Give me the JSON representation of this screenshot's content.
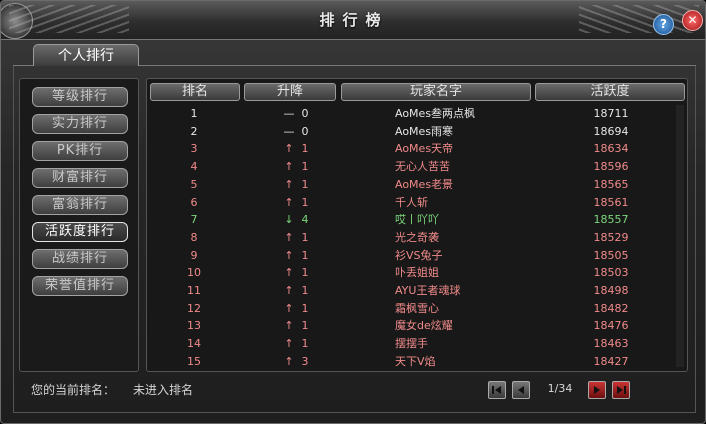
{
  "window": {
    "title": "排行榜",
    "help_label": "?",
    "close_label": "✕"
  },
  "tabs": [
    {
      "label": "个人排行"
    }
  ],
  "categories": [
    {
      "label": "等级排行",
      "active": false
    },
    {
      "label": "实力排行",
      "active": false
    },
    {
      "label": "PK排行",
      "active": false
    },
    {
      "label": "财富排行",
      "active": false
    },
    {
      "label": "富翁排行",
      "active": false
    },
    {
      "label": "活跃度排行",
      "active": true
    },
    {
      "label": "战绩排行",
      "active": false
    },
    {
      "label": "荣誉值排行",
      "active": false
    }
  ],
  "table": {
    "headers": [
      "排名",
      "升降",
      "玩家名字",
      "活跃度"
    ],
    "colors": {
      "white": "#e6e6e6",
      "red": "#f08a8a",
      "green": "#7cd87c"
    },
    "rows": [
      {
        "rank": "1",
        "arrow": "—",
        "change": "0",
        "name": "AoMes叁两点枫",
        "activity": "18711",
        "color": "white"
      },
      {
        "rank": "2",
        "arrow": "—",
        "change": "0",
        "name": "AoMes雨寒",
        "activity": "18694",
        "color": "white"
      },
      {
        "rank": "3",
        "arrow": "↑",
        "change": "1",
        "name": "AoMes天帝",
        "activity": "18634",
        "color": "red"
      },
      {
        "rank": "4",
        "arrow": "↑",
        "change": "1",
        "name": "无心人苦苦",
        "activity": "18596",
        "color": "red"
      },
      {
        "rank": "5",
        "arrow": "↑",
        "change": "1",
        "name": "AoMes老景",
        "activity": "18565",
        "color": "red"
      },
      {
        "rank": "6",
        "arrow": "↑",
        "change": "1",
        "name": "千人斩",
        "activity": "18561",
        "color": "red"
      },
      {
        "rank": "7",
        "arrow": "↓",
        "change": "4",
        "name": "哎丨吖吖",
        "activity": "18557",
        "color": "green"
      },
      {
        "rank": "8",
        "arrow": "↑",
        "change": "1",
        "name": "光之奇袭",
        "activity": "18529",
        "color": "red"
      },
      {
        "rank": "9",
        "arrow": "↑",
        "change": "1",
        "name": "衫VS兔子",
        "activity": "18505",
        "color": "red"
      },
      {
        "rank": "10",
        "arrow": "↑",
        "change": "1",
        "name": "卟丢姐姐",
        "activity": "18503",
        "color": "red"
      },
      {
        "rank": "11",
        "arrow": "↑",
        "change": "1",
        "name": "AYU王者魂球",
        "activity": "18498",
        "color": "red"
      },
      {
        "rank": "12",
        "arrow": "↑",
        "change": "1",
        "name": "霜枫雪心",
        "activity": "18482",
        "color": "red"
      },
      {
        "rank": "13",
        "arrow": "↑",
        "change": "1",
        "name": "魔女de炫耀",
        "activity": "18476",
        "color": "red"
      },
      {
        "rank": "14",
        "arrow": "↑",
        "change": "1",
        "name": "摆摆手",
        "activity": "18463",
        "color": "red"
      },
      {
        "rank": "15",
        "arrow": "↑",
        "change": "3",
        "name": "天下V焰",
        "activity": "18427",
        "color": "red"
      }
    ]
  },
  "status": {
    "label": "您的当前排名：",
    "value": "未进入排名"
  },
  "pagination": {
    "indicator": "1/34",
    "icons": [
      "first-page-icon",
      "prev-page-icon",
      "next-page-icon",
      "last-page-icon"
    ]
  }
}
